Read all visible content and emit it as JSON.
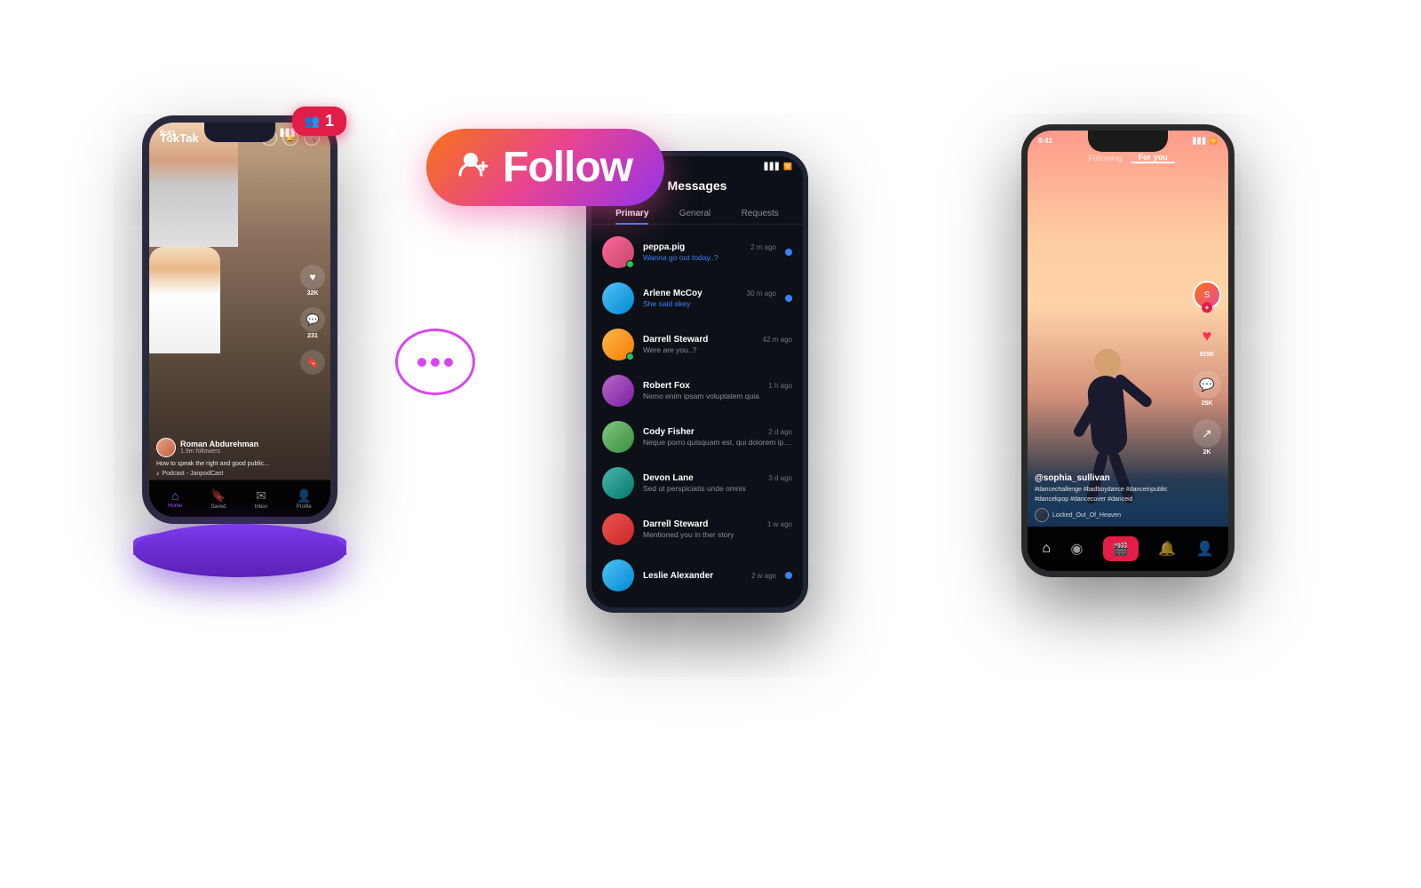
{
  "phone1": {
    "statusTime": "9:41",
    "appName": "TokTak",
    "creator": {
      "name": "Roman Abdurehman",
      "followers": "1.9m followers",
      "description": "How to speak the right and good public...",
      "music": "Podcast - JanpodCast"
    },
    "stats": {
      "likes": "32K",
      "comments": "231"
    },
    "nav": {
      "home": "Home",
      "saved": "Saved",
      "inbox": "Inbox",
      "profile": "Profile"
    }
  },
  "phone2": {
    "title": "Messages",
    "tabs": [
      "Primary",
      "General",
      "Requests"
    ],
    "messages": [
      {
        "name": "peppa.pig",
        "time": "2 m ago",
        "preview": "Wanna go out today..?",
        "highlight": true,
        "online": true
      },
      {
        "name": "Arlene McCoy",
        "time": "30 m ago",
        "preview": "She said okey",
        "highlight": true,
        "online": false
      },
      {
        "name": "Darrell Steward",
        "time": "42 m ago",
        "preview": "Were are you..?",
        "highlight": false,
        "online": true
      },
      {
        "name": "Robert Fox",
        "time": "1 h ago",
        "preview": "Nemo enim ipsam voluptatem quia",
        "highlight": false,
        "online": false
      },
      {
        "name": "Cody Fisher",
        "time": "2 d ago",
        "preview": "Neque porro quisquam est, qui dolorem ipsum",
        "highlight": false,
        "online": false
      },
      {
        "name": "Devon Lane",
        "time": "3 d ago",
        "preview": "Sed ut perspiciatis unde omnis",
        "highlight": false,
        "online": false
      },
      {
        "name": "Darrell Steward",
        "time": "1 w ago",
        "preview": "Mentioned you in ther story",
        "highlight": false,
        "online": false
      },
      {
        "name": "Leslie Alexander",
        "time": "2 w ago",
        "preview": "",
        "highlight": true,
        "online": false
      }
    ]
  },
  "phone3": {
    "tabs": [
      "Following",
      "For you"
    ],
    "creator": "@sophia_sullivan",
    "tags": "#dancechallenge #badboydance #danceinpublic\n#dancekpop #dancecover #danceid",
    "music": "Locked_Out_Of_Heaven",
    "stats": {
      "likes": "925K",
      "comments": "25K",
      "shares": "2K"
    }
  },
  "followButton": {
    "icon": "👤+",
    "label": "Follow"
  },
  "speechBubble": {
    "dots": [
      "•",
      "•",
      "•"
    ]
  },
  "notification": {
    "icon": "👥",
    "count": "1"
  },
  "colors": {
    "accent": "#7c3aed",
    "platform": "#7c3aed",
    "followGradientStart": "#f97316",
    "followGradientEnd": "#9333ea",
    "danger": "#e11d48"
  }
}
